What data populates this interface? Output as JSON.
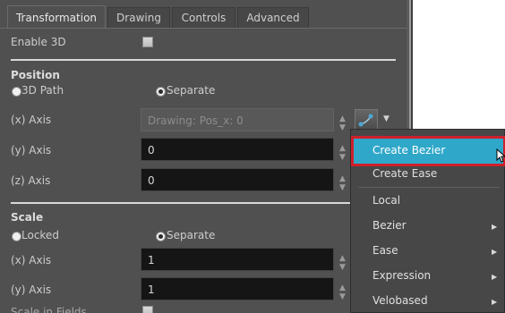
{
  "tabs": [
    "Transformation",
    "Drawing",
    "Controls",
    "Advanced"
  ],
  "enable_3d": {
    "label": "Enable 3D",
    "checked": false
  },
  "position": {
    "heading": "Position",
    "radio_path": "3D Path",
    "radio_separate": "Separate",
    "selected": "Separate",
    "x": {
      "label": "(x) Axis",
      "value": "Drawing: Pos_x: 0",
      "disabled": true
    },
    "y": {
      "label": "(y) Axis",
      "value": "0"
    },
    "z": {
      "label": "(z) Axis",
      "value": "0"
    }
  },
  "scale": {
    "heading": "Scale",
    "radio_locked": "Locked",
    "radio_separate": "Separate",
    "selected": "Separate",
    "x": {
      "label": "(x) Axis",
      "value": "1"
    },
    "y": {
      "label": "(y) Axis",
      "value": "1"
    },
    "scale_in_fields": "Scale in Fields"
  },
  "menu": {
    "items": [
      {
        "label": "Create Bezier",
        "highlighted": true
      },
      {
        "label": "Create Ease"
      },
      {
        "label": "Local"
      },
      {
        "label": "Bezier",
        "submenu": true
      },
      {
        "label": "Ease",
        "submenu": true
      },
      {
        "label": "Expression",
        "submenu": true
      },
      {
        "label": "Velobased",
        "submenu": true
      }
    ]
  },
  "colors": {
    "panel": "#505050",
    "highlight": "#2fa7c9",
    "highlight_border": "#d0202a",
    "field": "#151515"
  },
  "icons": {
    "function": "function-curve-icon",
    "dropdown": "chevron-down-icon",
    "submenu": "chevron-right-icon",
    "cursor": "mouse-pointer-icon"
  }
}
